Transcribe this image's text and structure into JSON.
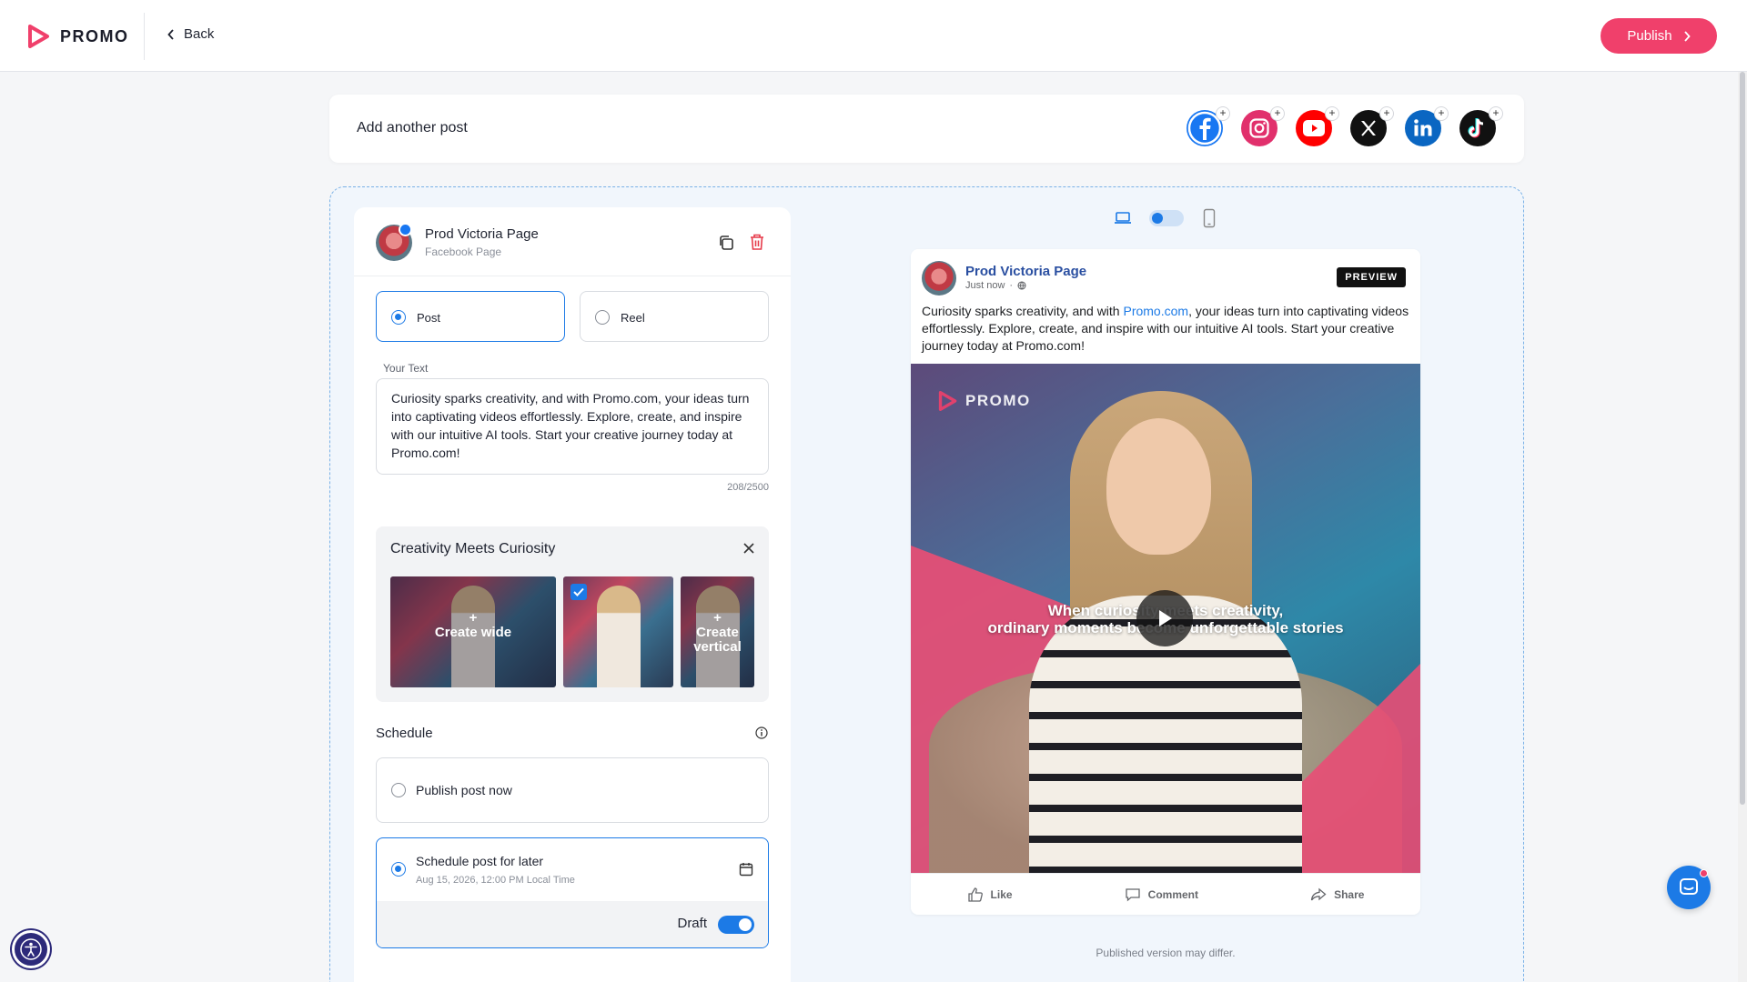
{
  "app": {
    "brand": "PROMO",
    "back_label": "Back",
    "publish_label": "Publish",
    "accent": "#f0406b",
    "primary": "#1c7ae6"
  },
  "add_post": {
    "label": "Add another post",
    "networks": [
      "facebook-icon",
      "instagram-icon",
      "youtube-icon",
      "x-icon",
      "linkedin-icon",
      "tiktok-icon"
    ]
  },
  "editor": {
    "account_name": "Prod Victoria Page",
    "account_type": "Facebook Page",
    "post_types": [
      {
        "label": "Post",
        "selected": true
      },
      {
        "label": "Reel",
        "selected": false
      }
    ],
    "text_label": "Your Text",
    "text_value": "Curiosity sparks creativity, and with Promo.com, your ideas turn into captivating videos effortlessly. Explore, create, and inspire with our intuitive AI tools. Start your creative journey today at Promo.com!",
    "char_count": "208/2500",
    "video": {
      "title": "Creativity Meets Curiosity",
      "thumbs": [
        {
          "label": "Create wide"
        },
        {
          "label": "",
          "selected": true
        },
        {
          "label": "Create vertical"
        }
      ],
      "plus": "+"
    },
    "schedule": {
      "label": "Schedule",
      "now_label": "Publish post now",
      "later_label": "Schedule post for later",
      "later_date": "Aug 15, 2026, 12:00 PM Local Time",
      "draft_label": "Draft",
      "draft_on": true,
      "selected": "later"
    }
  },
  "preview": {
    "account_name": "Prod Victoria Page",
    "time": "Just now",
    "dot": "·",
    "badge": "PREVIEW",
    "text_before": "Curiosity sparks creativity, and with ",
    "text_link": "Promo.com",
    "text_after": ", your ideas turn into captivating videos effortlessly. Explore, create, and inspire with our intuitive AI tools. Start your creative journey today at Promo.com!",
    "watermark": "PROMO",
    "caption_line1": "When curiosity meets creativity,",
    "caption_line2": "ordinary moments become unforgettable stories",
    "actions": {
      "like": "Like",
      "comment": "Comment",
      "share": "Share"
    },
    "disclaimer": "Published version may differ."
  }
}
